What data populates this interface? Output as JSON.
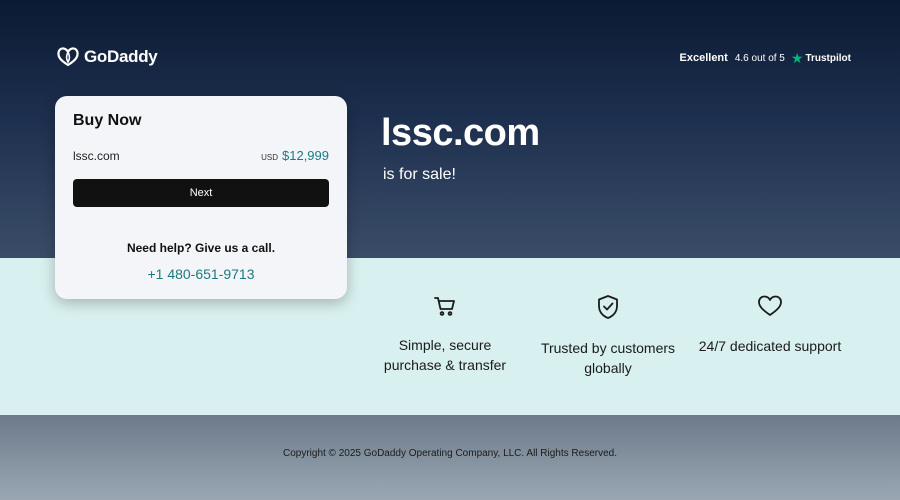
{
  "brand": {
    "name": "GoDaddy",
    "icon": "godaddy-logo-icon"
  },
  "trustpilot": {
    "label": "Excellent",
    "score": "4.6 out of 5",
    "star_icon": "star-icon",
    "brand": "Trustpilot",
    "star_color": "#00b67a"
  },
  "card": {
    "title": "Buy Now",
    "domain": "lssc.com",
    "currency": "USD",
    "price": "$12,999",
    "next_label": "Next",
    "help_text": "Need help? Give us a call.",
    "phone": "+1 480-651-9713"
  },
  "hero": {
    "domain": "lssc.com",
    "subtitle": "is for sale!"
  },
  "features": [
    {
      "icon": "cart-icon",
      "line1": "Simple, secure",
      "line2": "purchase & transfer"
    },
    {
      "icon": "shield-check-icon",
      "line1": "Trusted by customers",
      "line2": "globally"
    },
    {
      "icon": "heart-icon",
      "line1": "24/7 dedicated support",
      "line2": ""
    }
  ],
  "footer": {
    "copyright": "Copyright © 2025 GoDaddy Operating Company, LLC. All Rights Reserved."
  },
  "colors": {
    "accent": "#1a7a80",
    "hero_dark": "#0b1a33",
    "band": "#d8f0ef"
  }
}
